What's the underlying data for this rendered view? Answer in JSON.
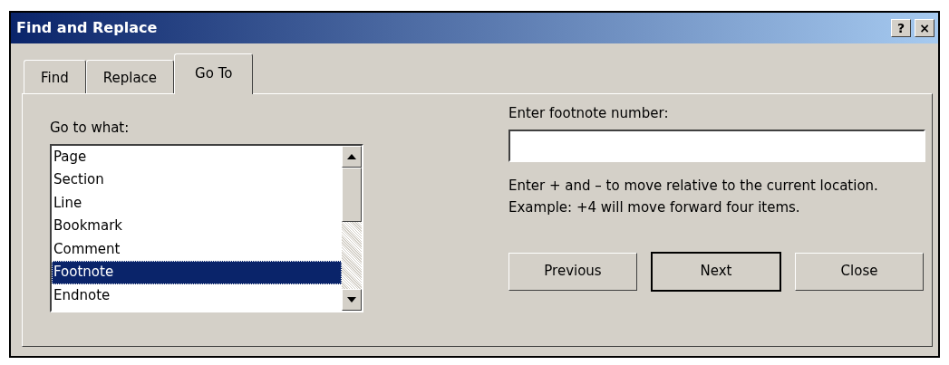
{
  "window": {
    "title": "Find and Replace",
    "title_buttons": [
      "?",
      "×"
    ]
  },
  "tabs": [
    {
      "label": "Find",
      "selected": false
    },
    {
      "label": "Replace",
      "selected": false
    },
    {
      "label": "Go To",
      "selected": true
    }
  ],
  "go_to_what": {
    "label": "Go to what:",
    "items": [
      {
        "label": "Page",
        "selected": false
      },
      {
        "label": "Section",
        "selected": false
      },
      {
        "label": "Line",
        "selected": false
      },
      {
        "label": "Bookmark",
        "selected": false
      },
      {
        "label": "Comment",
        "selected": false
      },
      {
        "label": "Footnote",
        "selected": true
      },
      {
        "label": "Endnote",
        "selected": false
      }
    ]
  },
  "number_field": {
    "label": "Enter footnote number:"
  },
  "hint": "Enter + and – to move relative to the current location. Example: +4 will move forward four items.",
  "buttons": [
    {
      "label": "Previous",
      "default": false
    },
    {
      "label": "Next",
      "default": true
    },
    {
      "label": "Close",
      "default": false
    }
  ]
}
